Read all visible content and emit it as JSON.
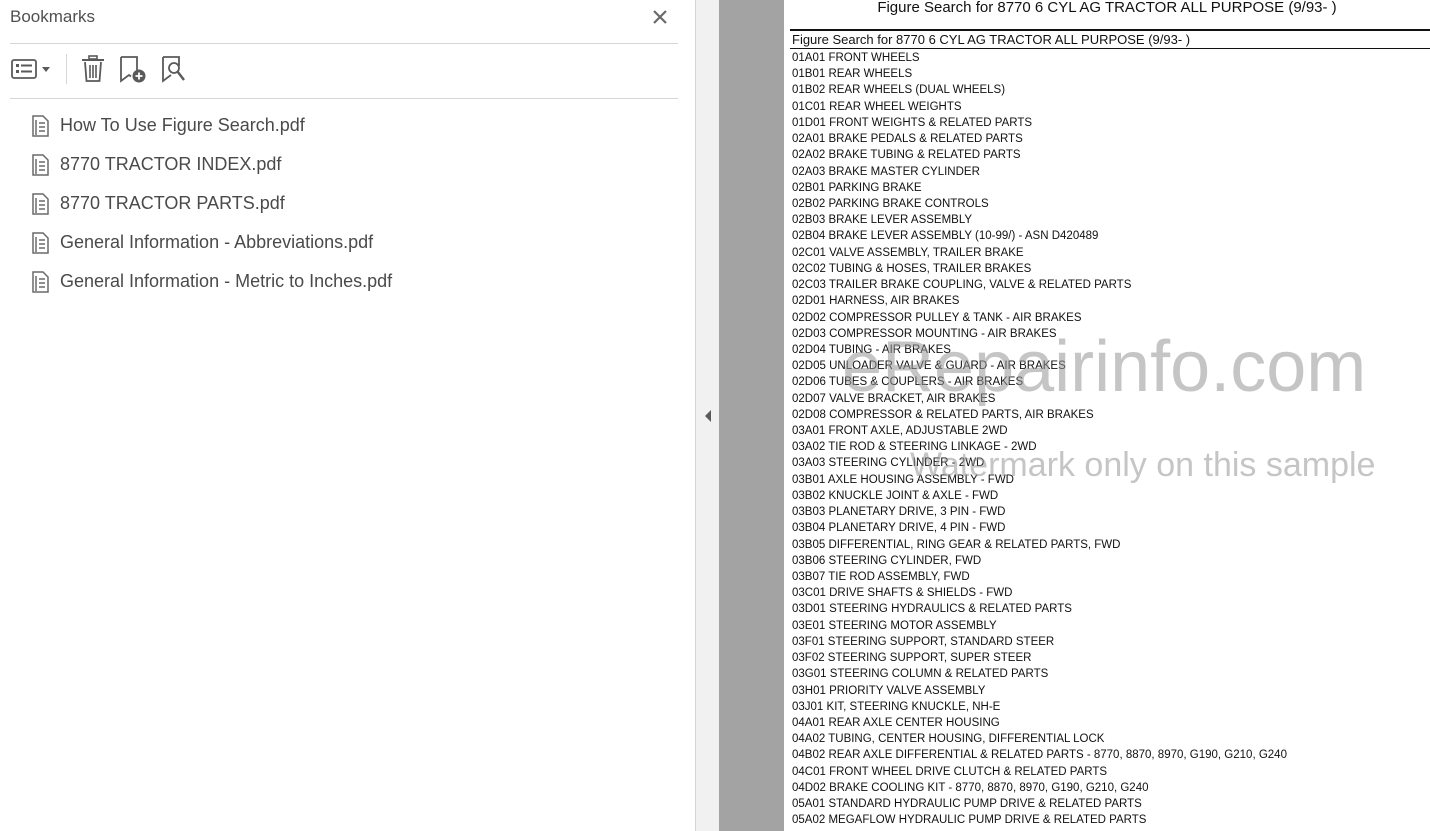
{
  "bookmarks_panel": {
    "title": "Bookmarks",
    "toolbar": {
      "options_icon": "list-options-icon",
      "delete_icon": "trash-icon",
      "add_bookmark_icon": "bookmark-add-icon",
      "find_bookmark_icon": "bookmark-search-icon"
    },
    "items": [
      {
        "label": "How To Use Figure Search.pdf"
      },
      {
        "label": "8770 TRACTOR INDEX.pdf"
      },
      {
        "label": "8770 TRACTOR PARTS.pdf"
      },
      {
        "label": "General Information - Abbreviations.pdf"
      },
      {
        "label": "General Information - Metric to Inches.pdf"
      }
    ]
  },
  "document": {
    "title": "Figure Search for 8770 6 CYL AG TRACTOR ALL PURPOSE (9/93- )",
    "table_title": "Figure Search for 8770 6 CYL AG TRACTOR ALL PURPOSE (9/93- )",
    "entries": [
      "01A01 FRONT WHEELS",
      "01B01 REAR WHEELS",
      "01B02 REAR WHEELS (DUAL WHEELS)",
      "01C01 REAR WHEEL WEIGHTS",
      "01D01 FRONT WEIGHTS & RELATED PARTS",
      "02A01 BRAKE PEDALS & RELATED PARTS",
      "02A02 BRAKE TUBING & RELATED PARTS",
      "02A03 BRAKE MASTER CYLINDER",
      "02B01 PARKING BRAKE",
      "02B02 PARKING BRAKE CONTROLS",
      "02B03 BRAKE LEVER ASSEMBLY",
      "02B04 BRAKE LEVER ASSEMBLY (10-99/) - ASN D420489",
      "02C01 VALVE ASSEMBLY, TRAILER BRAKE",
      "02C02 TUBING & HOSES, TRAILER BRAKES",
      "02C03 TRAILER BRAKE COUPLING, VALVE & RELATED PARTS",
      "02D01 HARNESS, AIR BRAKES",
      "02D02 COMPRESSOR PULLEY & TANK - AIR BRAKES",
      "02D03 COMPRESSOR MOUNTING - AIR BRAKES",
      "02D04 TUBING - AIR BRAKES",
      "02D05 UNLOADER VALVE & GUARD - AIR BRAKES",
      "02D06 TUBES & COUPLERS - AIR BRAKES",
      "02D07 VALVE BRACKET, AIR BRAKES",
      "02D08 COMPRESSOR & RELATED PARTS, AIR BRAKES",
      "03A01 FRONT AXLE, ADJUSTABLE 2WD",
      "03A02 TIE ROD & STEERING LINKAGE - 2WD",
      "03A03 STEERING CYLINDER - 2WD",
      "03B01 AXLE HOUSING ASSEMBLY - FWD",
      "03B02 KNUCKLE JOINT & AXLE - FWD",
      "03B03 PLANETARY DRIVE, 3 PIN - FWD",
      "03B04 PLANETARY DRIVE, 4 PIN - FWD",
      "03B05 DIFFERENTIAL, RING GEAR & RELATED PARTS, FWD",
      "03B06 STEERING CYLINDER, FWD",
      "03B07 TIE ROD ASSEMBLY, FWD",
      "03C01 DRIVE SHAFTS & SHIELDS - FWD",
      "03D01 STEERING HYDRAULICS & RELATED PARTS",
      "03E01 STEERING MOTOR ASSEMBLY",
      "03F01 STEERING SUPPORT, STANDARD STEER",
      "03F02 STEERING SUPPORT, SUPER STEER",
      "03G01 STEERING COLUMN & RELATED PARTS",
      "03H01 PRIORITY VALVE ASSEMBLY",
      "03J01 KIT, STEERING KNUCKLE, NH-E",
      "04A01 REAR AXLE CENTER HOUSING",
      "04A02 TUBING, CENTER HOUSING, DIFFERENTIAL LOCK",
      "04B02 REAR AXLE DIFFERENTIAL & RELATED PARTS - 8770, 8870, 8970, G190, G210, G240",
      "04C01 FRONT WHEEL DRIVE CLUTCH & RELATED PARTS",
      "04D02 BRAKE COOLING KIT - 8770, 8870, 8970, G190, G210, G240",
      "05A01 STANDARD HYDRAULIC PUMP DRIVE & RELATED PARTS",
      "05A02 MEGAFLOW HYDRAULIC PUMP DRIVE & RELATED PARTS"
    ]
  },
  "watermark": {
    "main": "eRepairinfo.com",
    "sub": "Watermark only on this sample"
  },
  "colors": {
    "gutter": "#a3a3a3",
    "panel_text": "#4a4a4a",
    "icon": "#5a5a5a"
  }
}
